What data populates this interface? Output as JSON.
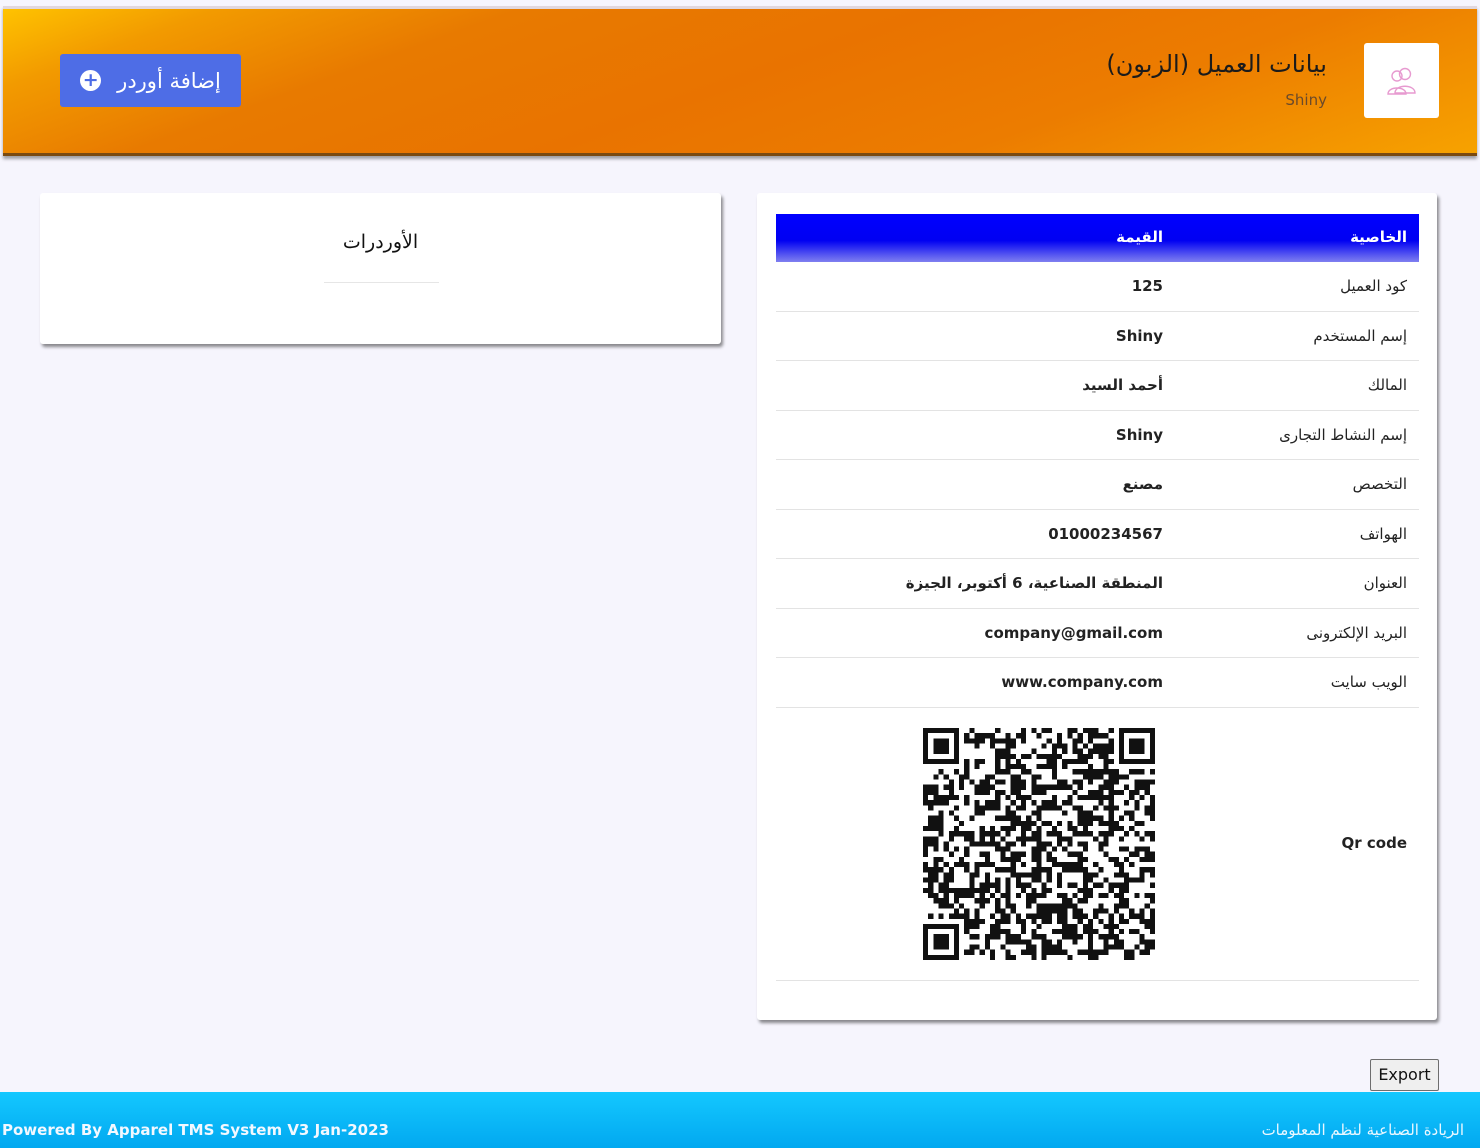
{
  "header": {
    "title": "بيانات العميل (الزبون)",
    "subtitle": "Shiny",
    "add_order_label": "إضافة أوردر",
    "avatar_icon": "users-icon"
  },
  "orders": {
    "title": "الأوردرات"
  },
  "table": {
    "headers": {
      "property": "الخاصية",
      "value": "القيمة"
    },
    "rows": [
      {
        "property": "كود العميل",
        "value": "125"
      },
      {
        "property": "إسم المستخدم",
        "value": "Shiny"
      },
      {
        "property": "المالك",
        "value": "أحمد السيد"
      },
      {
        "property": "إسم النشاط التجارى",
        "value": "Shiny"
      },
      {
        "property": "التخصص",
        "value": "مصنع"
      },
      {
        "property": "الهواتف",
        "value": "01000234567"
      },
      {
        "property": "العنوان",
        "value": "المنطقة الصناعية، 6 أكتوبر، الجيزة"
      },
      {
        "property": "البريد الإلكترونى",
        "value": "company@gmail.com"
      },
      {
        "property": "الويب سايت",
        "value": "www.company.com"
      }
    ],
    "qr_label": "Qr code"
  },
  "export_label": "Export",
  "footer": {
    "left": "Powered By Apparel TMS System V3 Jan-2023",
    "right": "الريادة الصناعية لنظم المعلومات"
  },
  "colors": {
    "header_accent": "#e97300",
    "button_blue": "#4e6de6",
    "table_header_blue": "#0000ff",
    "footer_blue": "#02a8f0"
  }
}
